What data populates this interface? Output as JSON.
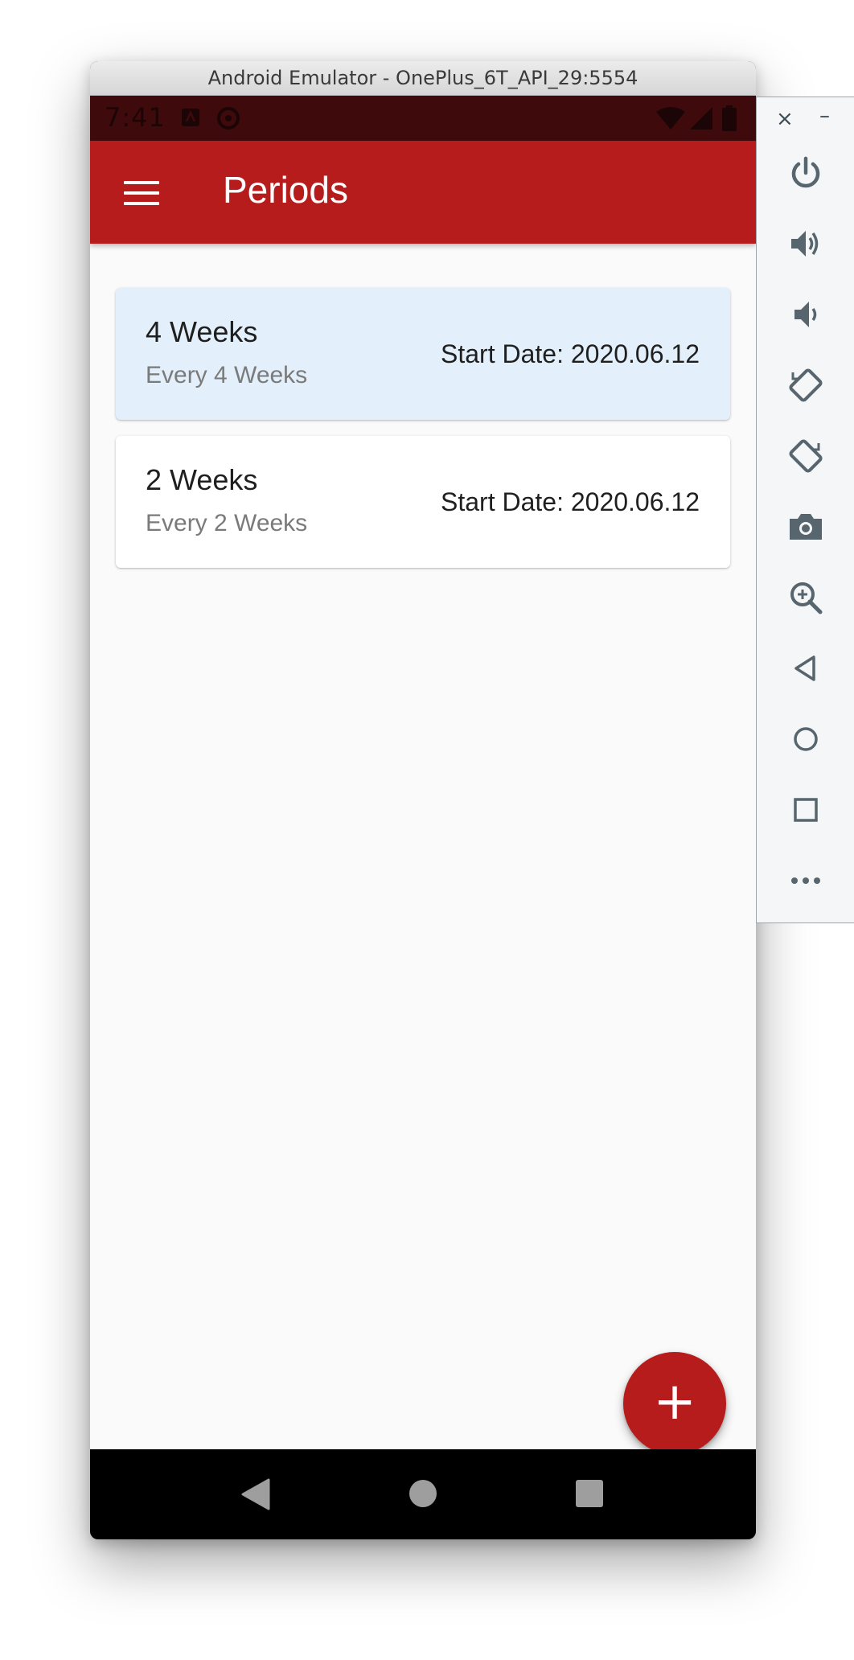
{
  "window": {
    "title": "Android Emulator - OnePlus_6T_API_29:5554"
  },
  "status_bar": {
    "time": "7:41",
    "icons": [
      "notification-app-icon",
      "sync-icon",
      "wifi-icon",
      "signal-icon",
      "battery-icon"
    ]
  },
  "app_bar": {
    "title": "Periods",
    "menu_icon": "hamburger-menu-icon",
    "color": "#b71c1c"
  },
  "periods": [
    {
      "title": "4 Weeks",
      "subtitle": "Every 4 Weeks",
      "start_date": "Start Date: 2020.06.12",
      "selected": true
    },
    {
      "title": "2 Weeks",
      "subtitle": "Every 2 Weeks",
      "start_date": "Start Date: 2020.06.12",
      "selected": false
    }
  ],
  "fab": {
    "label": "+",
    "icon": "add-icon"
  },
  "nav_bar": {
    "buttons": [
      "back-icon",
      "home-icon",
      "recents-icon"
    ]
  },
  "toolbar": {
    "close_label": "×",
    "minimize_label": "–",
    "buttons": [
      "power-icon",
      "volume-up-icon",
      "volume-down-icon",
      "rotate-left-icon",
      "rotate-right-icon",
      "camera-icon",
      "zoom-icon",
      "back-icon",
      "home-icon",
      "overview-icon",
      "more-icon"
    ]
  }
}
